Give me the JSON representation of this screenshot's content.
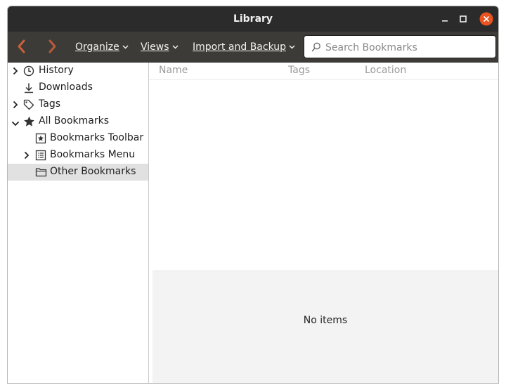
{
  "window": {
    "title": "Library"
  },
  "toolbar": {
    "organize_label": "Organize",
    "views_label": "Views",
    "import_backup_label": "Import and Backup",
    "search_placeholder": "Search Bookmarks",
    "search_value": ""
  },
  "sidebar": {
    "items": [
      {
        "label": "History",
        "icon": "clock-icon",
        "expandable": true,
        "expanded": false
      },
      {
        "label": "Downloads",
        "icon": "download-icon",
        "expandable": false
      },
      {
        "label": "Tags",
        "icon": "tag-icon",
        "expandable": true,
        "expanded": false
      },
      {
        "label": "All Bookmarks",
        "icon": "star-icon",
        "expandable": true,
        "expanded": true
      },
      {
        "label": "Bookmarks Toolbar",
        "icon": "bookmark-toolbar-icon",
        "expandable": false
      },
      {
        "label": "Bookmarks Menu",
        "icon": "bookmark-menu-icon",
        "expandable": true,
        "expanded": false
      },
      {
        "label": "Other Bookmarks",
        "icon": "folder-icon",
        "expandable": false,
        "selected": true
      }
    ]
  },
  "columns": [
    "Name",
    "Tags",
    "Location"
  ],
  "details": {
    "empty_text": "No items"
  },
  "colors": {
    "titlebar": "#2b2b2b",
    "toolbar": "#3c3b37",
    "close_button": "#e95420",
    "nav_arrow": "#c8603a",
    "selected_row": "#e1e1e1"
  }
}
